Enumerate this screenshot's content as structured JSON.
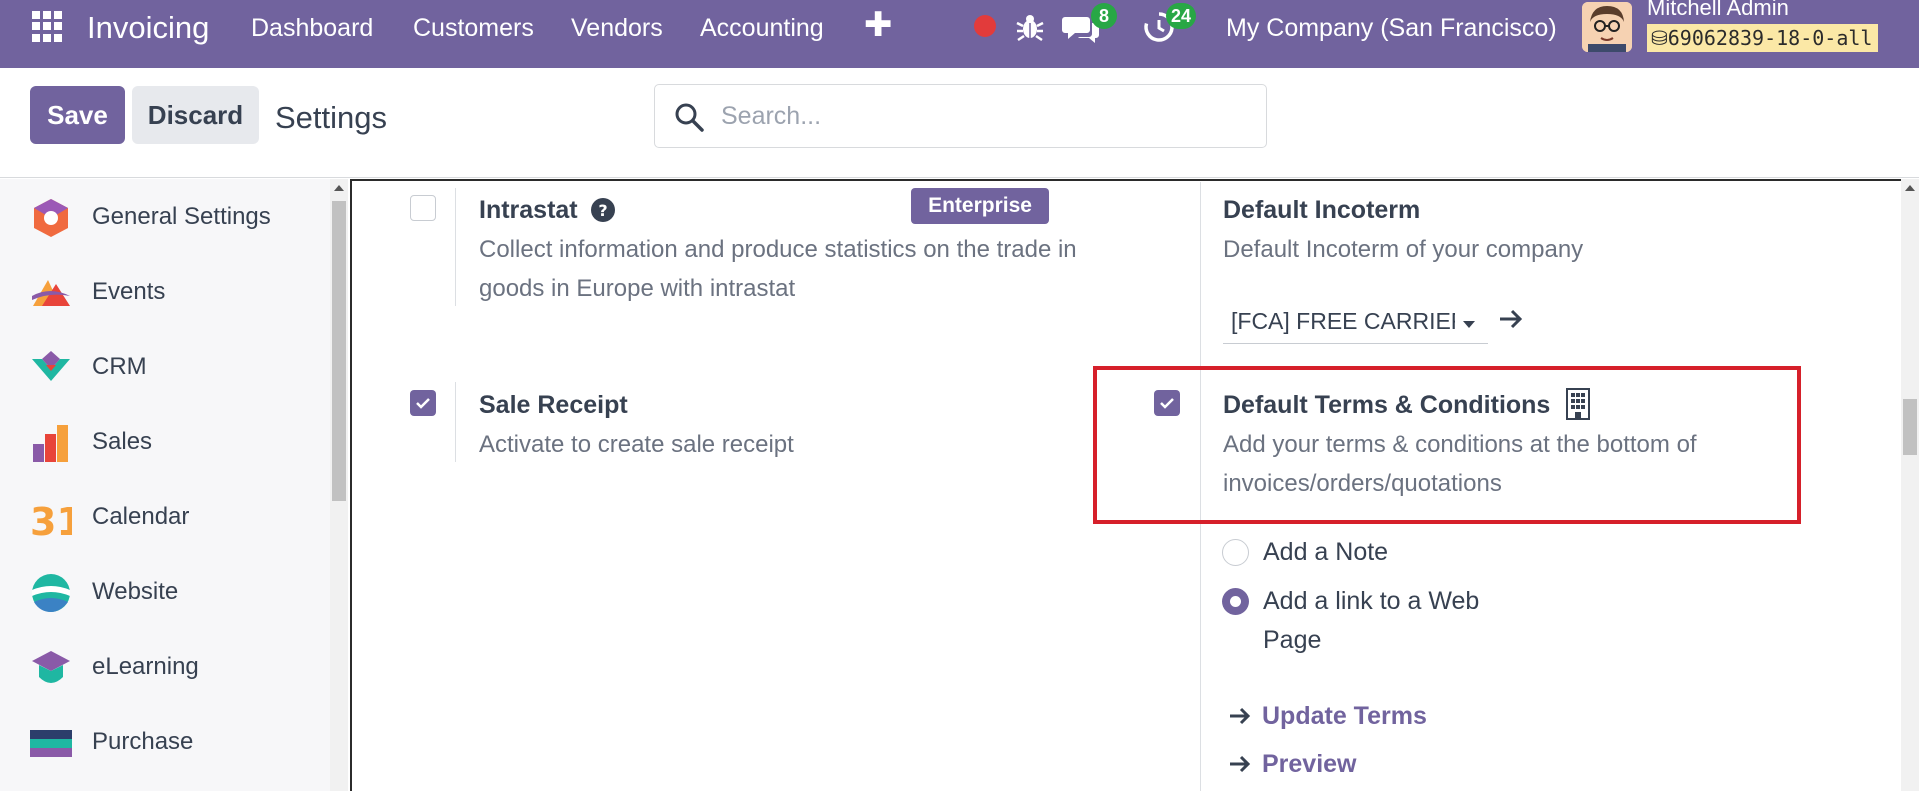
{
  "navbar": {
    "brand": "Invoicing",
    "menu": [
      "Dashboard",
      "Customers",
      "Vendors",
      "Accounting"
    ],
    "chat_count": "8",
    "activity_count": "24",
    "company": "My Company (San Francisco)",
    "user_name": "Mitchell Admin",
    "database": "69062839-18-0-all"
  },
  "control": {
    "save_label": "Save",
    "discard_label": "Discard",
    "title": "Settings",
    "search_placeholder": "Search..."
  },
  "sidebar": {
    "items": [
      {
        "label": "General Settings",
        "icon": "general-settings-icon"
      },
      {
        "label": "Events",
        "icon": "events-icon"
      },
      {
        "label": "CRM",
        "icon": "crm-icon"
      },
      {
        "label": "Sales",
        "icon": "sales-icon"
      },
      {
        "label": "Calendar",
        "icon": "calendar-icon",
        "icon_text": "31"
      },
      {
        "label": "Website",
        "icon": "website-icon"
      },
      {
        "label": "eLearning",
        "icon": "elearning-icon"
      },
      {
        "label": "Purchase",
        "icon": "purchase-icon"
      }
    ]
  },
  "settings": {
    "intrastat": {
      "title": "Intrastat",
      "badge": "Enterprise",
      "description": "Collect information and produce statistics on the trade in goods in Europe with intrastat",
      "checked": false
    },
    "incoterm": {
      "title": "Default Incoterm",
      "description": "Default Incoterm of your company",
      "value": "[FCA] FREE CARRIER"
    },
    "sale_receipt": {
      "title": "Sale Receipt",
      "description": "Activate to create sale receipt",
      "checked": true
    },
    "terms": {
      "title": "Default Terms & Conditions",
      "description": "Add your terms & conditions at the bottom of invoices/orders/quotations",
      "checked": true,
      "options": [
        {
          "label": "Add a Note",
          "selected": false
        },
        {
          "label": "Add a link to a Web Page",
          "selected": true
        }
      ],
      "update_label": "Update Terms",
      "preview_label": "Preview"
    }
  },
  "colors": {
    "primary": "#71639e",
    "highlight": "#d6202a",
    "badge_green": "#28a745"
  }
}
